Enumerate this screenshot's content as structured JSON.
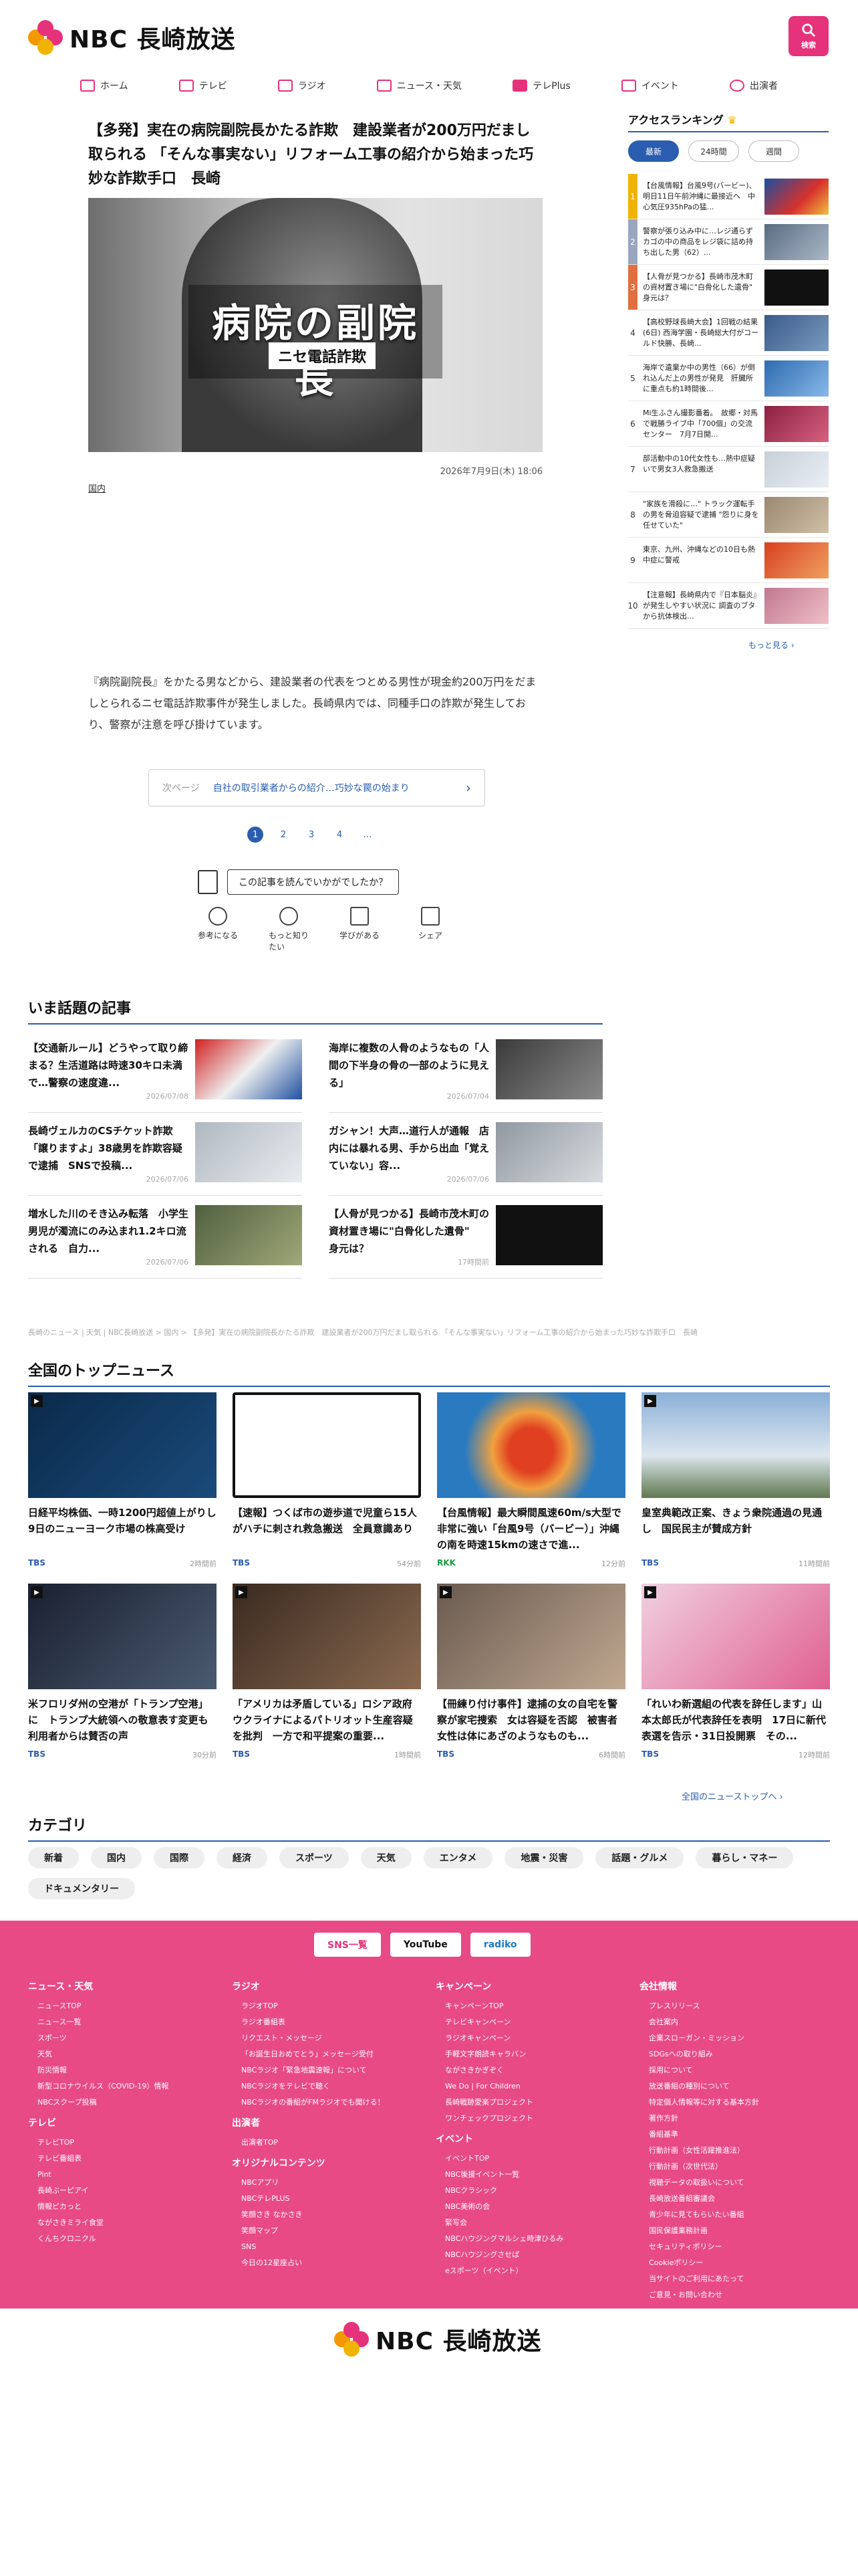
{
  "header": {
    "logo_text": "NBC 長崎放送",
    "search_label": "検索"
  },
  "nav": [
    {
      "label": "ホーム",
      "icon": "home-icon"
    },
    {
      "label": "テレビ",
      "icon": "tv-icon"
    },
    {
      "label": "ラジオ",
      "icon": "radio-icon"
    },
    {
      "label": "ニュース・天気",
      "icon": "news-icon"
    },
    {
      "label": "テレPlus",
      "icon": "play-icon"
    },
    {
      "label": "イベント",
      "icon": "calendar-icon"
    },
    {
      "label": "出演者",
      "icon": "people-icon"
    }
  ],
  "article": {
    "title": "【多発】実在の病院副院長かたる詐欺　建設業者が200万円だまし取られる 「そんな事実ない」リフォーム工事の紹介から始まった巧妙な詐欺手口　長崎",
    "hero_big": "病院の副院長",
    "hero_small": "ニセ電話詐欺",
    "date": "2026年7月9日(木) 18:06",
    "category": "国内",
    "body": "『病院副院長』をかたる男などから、建設業者の代表をつとめる男性が現金約200万円をだましとられるニセ電話詐欺事件が発生しました。長崎県内では、同種手口の詐欺が発生しており、警察が注意を呼び掛けています。",
    "next_label": "次ページ",
    "next_title": "自社の取引業者からの紹介…巧妙な罠の始まり",
    "pages": [
      "1",
      "2",
      "3",
      "4",
      "…"
    ],
    "survey_q": "この記事を読んでいかがでしたか？",
    "reactions": [
      "参考になる",
      "もっと知りたい",
      "学びがある",
      "シェア"
    ]
  },
  "ranking": {
    "title": "アクセスランキング",
    "tabs": [
      "最新",
      "24時間",
      "週間"
    ],
    "items": [
      {
        "n": "1",
        "text": "【台風情報】台風9号(バービー)、明日11日午前沖縄に最接近へ　中心気圧935hPaの猛..."
      },
      {
        "n": "2",
        "text": "警察が張り込み中に…レジ通らずカゴの中の商品をレジ袋に詰め持ち出した男（62）..."
      },
      {
        "n": "3",
        "text": "【人骨が見つかる】長崎市茂木町の資材置き場に\"白骨化した遺骨\"　身元は？"
      },
      {
        "n": "4",
        "text": "【高校野球長崎大会】1回戦の結果(6日) 西海学園・長崎総大付がコールド快勝、長崎..."
      },
      {
        "n": "5",
        "text": "海岸で遺棄か中の男性（66）が倒れ込んだ上の男性が発見　肝臓所に重点も約1時間後..."
      },
      {
        "n": "6",
        "text": "Mi生ふさん撮影番着。　故郷・対馬で戦勝ライブ中「700個」の交流センター　7月7日開..."
      },
      {
        "n": "7",
        "text": "部活動中の10代女性も…熱中症疑いで男女3人救急搬送"
      },
      {
        "n": "8",
        "text": "\"家族を滑殺に…\" トラック運転手の男を脅迫容疑で逮捕 \"怨りに身を任せていた\""
      },
      {
        "n": "9",
        "text": "東京、九州、沖縄などの10日も熱中症に警戒"
      },
      {
        "n": "10",
        "text": "【注意報】長崎県内で『日本脳炎』が発生しやすい状況に 調査のブタから抗体検出..."
      }
    ],
    "more": "もっと見る ›"
  },
  "topics": {
    "title": "いま話題の記事",
    "items": [
      {
        "text": "【交通新ルール】どうやって取り締まる？生活道路は時速30キロ未満で…警察の速度違...",
        "date": "2026/07/08"
      },
      {
        "text": "海岸に複数の人骨のようなもの「人間の下半身の骨の一部のように見える」",
        "date": "2026/07/04"
      },
      {
        "text": "長崎ヴェルカのCSチケット詐欺「譲りますよ」38歳男を詐欺容疑で逮捕　SNSで投稿...",
        "date": "2026/07/06"
      },
      {
        "text": "ガシャン！大声…道行人が通報　店内には暴れる男、手から出血「覚えていない」容...",
        "date": "2026/07/06"
      },
      {
        "text": "増水した川のそき込み転落　小学生男児が濁流にのみ込まれ1.2キロ流される　自力...",
        "date": "2026/07/06"
      },
      {
        "text": "【人骨が見つかる】長崎市茂木町の資材置き場に\"白骨化した遺骨\"　身元は？",
        "date": "17時間前"
      }
    ]
  },
  "breadcrumb": "長崎のニュース | 天気 | NBC長崎放送 > 国内 > 【多発】実在の病院副院長かたる詐欺　建設業者が200万円だまし取られる 「そんな事実ない」リフォーム工事の紹介から始まった巧妙な詐欺手口　長崎",
  "national": {
    "title": "全国のトップニュース",
    "items": [
      {
        "text": "日経平均株価、一時1200円超値上がりし　9日のニューヨーク市場の株高受け",
        "src": "TBS",
        "time": "2時間前"
      },
      {
        "text": "【速報】つくば市の遊歩道で児童ら15人がハチに刺され救急搬送　全員意識あり",
        "src": "TBS",
        "time": "54分前"
      },
      {
        "text": "【台風情報】最大瞬間風速60m/s大型で非常に強い「台風9号（バービー）」沖縄の南を時速15kmの速さで進...",
        "src": "RKK",
        "time": "12分前"
      },
      {
        "text": "皇室典範改正案、きょう衆院通過の見通し　国民民主が賛成方針",
        "src": "TBS",
        "time": "11時間前"
      },
      {
        "text": "米フロリダ州の空港が「トランプ空港」に　トランプ大統領への敬意表す変更も 利用者からは賛否の声",
        "src": "TBS",
        "time": "30分前"
      },
      {
        "text": "「アメリカは矛盾している」ロシア政府 ウクライナによるパトリオット生産容疑を批判　一方で和平提案の重要...",
        "src": "TBS",
        "time": "1時間前"
      },
      {
        "text": "【冊練り付け事件】逮捕の女の自宅を警察が家宅捜索　女は容疑を否認　被害者女性は体にあざのようなものも...",
        "src": "TBS",
        "time": "6時間前"
      },
      {
        "text": "「れいわ新選組の代表を辞任します」山本太郎氏が代表辞任を表明　17日に新代表選を告示・31日投開票　その...",
        "src": "TBS",
        "time": "12時間前"
      }
    ],
    "more": "全国のニューストップへ ›"
  },
  "categories": {
    "title": "カテゴリ",
    "items": [
      "新着",
      "国内",
      "国際",
      "経済",
      "スポーツ",
      "天気",
      "エンタメ",
      "地震・災害",
      "話題・グルメ",
      "暮らし・マネー",
      "ドキュメンタリー"
    ]
  },
  "footer": {
    "sns": [
      "SNS一覧",
      "YouTube",
      "radiko"
    ],
    "columns": [
      [
        {
          "h": "ニュース・天気",
          "items": [
            "ニュースTOP",
            "ニュース一覧",
            "スポーツ",
            "天気",
            "防災情報",
            "新型コロナウイルス（COVID-19）情報",
            "NBCスクープ投稿"
          ]
        },
        {
          "h": "テレビ",
          "items": [
            "テレビTOP",
            "テレビ番組表",
            "Pint",
            "長崎ぶーピアイ",
            "情報ピカっと",
            "ながさきミライ食堂",
            "くんちクロニクル"
          ]
        }
      ],
      [
        {
          "h": "ラジオ",
          "items": [
            "ラジオTOP",
            "ラジオ番組表",
            "リクエスト・メッセージ",
            "「お誕生日おめでとう」メッセージ受付",
            "NBCラジオ「緊急地震速報」について",
            "NBCラジオをテレビで聴く",
            "NBCラジオの番組がFMラジオでも聞ける！"
          ]
        },
        {
          "h": "出演者",
          "items": [
            "出演者TOP"
          ]
        },
        {
          "h": "オリジナルコンテンツ",
          "items": [
            "NBCアプリ",
            "NBCテレPLUS",
            "笑顔さき なかさき",
            "笑顔マップ",
            "SNS",
            "今日の12星座占い"
          ]
        }
      ],
      [
        {
          "h": "キャンペーン",
          "items": [
            "キャンペーンTOP",
            "テレビキャンペーン",
            "ラジオキャンペーン",
            "手軽文字朗読キャラバン",
            "ながさきかぎぞく",
            "We Do | For Children",
            "長崎戦跡愛楽プロジェクト",
            "ワンチェックプロジェクト"
          ]
        },
        {
          "h": "イベント",
          "items": [
            "イベントTOP",
            "NBC後援イベント一覧",
            "NBCクラシック",
            "NBC美術の会",
            "緊写会",
            "NBCハウジングマルシェ時津ひるみ",
            "NBCハウジングさせば",
            "eスポーツ（イベント）"
          ]
        }
      ],
      [
        {
          "h": "会社情報",
          "items": [
            "プレスリリース",
            "会社案内",
            "企業スローガン・ミッション",
            "SDGsへの取り組み",
            "採用について",
            "放送番組の種別について",
            "特定個人情報等に対する基本方針",
            "著作方針",
            "番組基準",
            "行動計画（女性活躍推進法）",
            "行動計画（次世代法）",
            "視聴データの取扱いについて",
            "長崎放送番組審議会",
            "青少年に見てもらいたい番組",
            "国民保護業務計画",
            "セキュリティポリシー",
            "Cookieポリシー",
            "当サイトのご利用にあたって",
            "ご意見・お問い合わせ"
          ]
        }
      ]
    ],
    "logo_text": "NBC 長崎放送"
  }
}
